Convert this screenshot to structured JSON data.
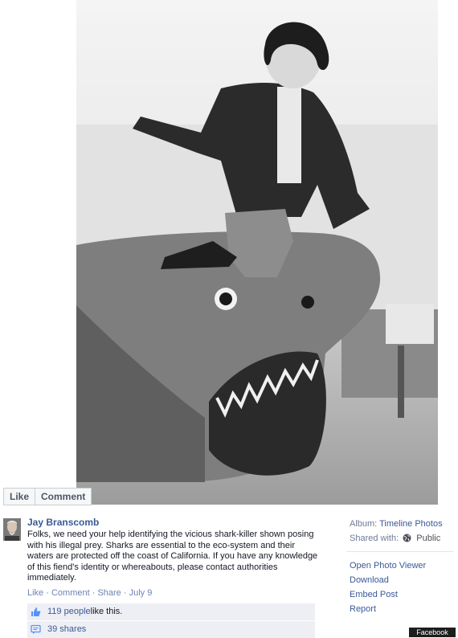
{
  "photo": {
    "actions": {
      "like_label": "Like",
      "comment_label": "Comment"
    }
  },
  "post": {
    "author": "Jay Branscomb",
    "text": "Folks, we need your help identifying the vicious shark-killer shown posing with his illegal prey. Sharks are essential to the eco-system and their waters are protected off the coast of California. If you have any knowledge of this fiend's identity or whereabouts, please contact authorities immediately.",
    "actions": {
      "like": "Like",
      "comment": "Comment",
      "share": "Share",
      "date": "July 9",
      "sep": " · "
    },
    "likes": {
      "count": "119 people",
      "suffix": " like this."
    },
    "shares": {
      "count": "39 shares"
    }
  },
  "sidebar": {
    "album_label": "Album:",
    "album_name": "Timeline Photos",
    "shared_label": "Shared with:",
    "shared_value": "Public",
    "menu": [
      "Open Photo Viewer",
      "Download",
      "Embed Post",
      "Report"
    ]
  },
  "badge": {
    "text": "Facebook"
  },
  "icons": {
    "like": "thumbs-up-icon",
    "share": "share-icon",
    "privacy": "globe-icon"
  },
  "colors": {
    "link": "#3b5998",
    "meta": "#6e7b96",
    "box": "#edeff4"
  }
}
